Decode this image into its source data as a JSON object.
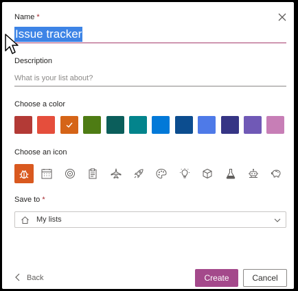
{
  "dialog": {
    "name_label": "Name",
    "required_mark": "*",
    "name_value": "Issue tracker",
    "description_label": "Description",
    "description_placeholder": "What is your list about?",
    "color_label": "Choose a color",
    "colors": [
      "#b33a36",
      "#e54e3c",
      "#d56417",
      "#4e7c14",
      "#0b5e5b",
      "#03848c",
      "#0279d8",
      "#0c4d8f",
      "#4e7ae8",
      "#363585",
      "#7059b6",
      "#c77eb6"
    ],
    "selected_color_index": 2,
    "icon_label": "Choose an icon",
    "icons": [
      "bug-icon",
      "calendar-icon",
      "target-icon",
      "clipboard-icon",
      "airplane-icon",
      "rocket-icon",
      "palette-icon",
      "lightbulb-icon",
      "cube-icon",
      "flask-icon",
      "robot-icon",
      "piggy-bank-icon"
    ],
    "selected_icon_index": 0,
    "save_to_label": "Save to",
    "save_to_value": "My lists",
    "back_label": "Back",
    "create_label": "Create",
    "cancel_label": "Cancel"
  }
}
